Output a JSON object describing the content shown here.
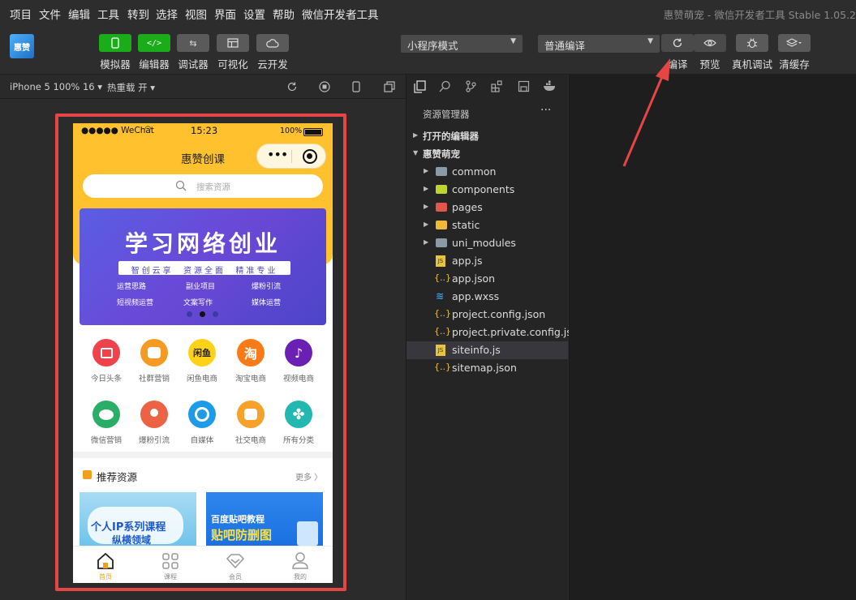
{
  "menu": [
    "项目",
    "文件",
    "编辑",
    "工具",
    "转到",
    "选择",
    "视图",
    "界面",
    "设置",
    "帮助",
    "微信开发者工具"
  ],
  "window_title": "惠赞萌宠 - 微信开发者工具 Stable 1.05.2",
  "logo_text": "惠赞",
  "toolbar": {
    "left_buttons": [
      "模拟器",
      "编辑器",
      "调试器",
      "可视化",
      "云开发"
    ],
    "mode_select": "小程序模式",
    "compile_select": "普通编译",
    "right_buttons": [
      "编译",
      "预览",
      "真机调试",
      "清缓存"
    ]
  },
  "simulator_bar": {
    "device": "iPhone 5 100% 16",
    "hot_reload": "热重载 开"
  },
  "explorer": {
    "title": "资源管理器",
    "more": "···",
    "open_editors": "打开的编辑器",
    "project": "惠赞萌宠",
    "folders": [
      "common",
      "components",
      "pages",
      "static",
      "uni_modules"
    ],
    "files": [
      "app.js",
      "app.json",
      "app.wxss",
      "project.config.json",
      "project.private.config.js...",
      "siteinfo.js",
      "sitemap.json"
    ],
    "selected": "siteinfo.js"
  },
  "phone": {
    "status_carrier": "●●●●● WeChat",
    "status_time": "15:23",
    "status_battery": "100%",
    "nav_title": "惠赞创课",
    "capsule_dots": "•••",
    "search_placeholder": "搜索资源",
    "banner": {
      "title": "学习网络创业",
      "subtitle": "智创云享  资源全面  精准专业",
      "tags": [
        "运营思路",
        "副业项目",
        "爆粉引流",
        "短视频运营",
        "文案写作",
        "媒体运营"
      ]
    },
    "categories": [
      {
        "label": "今日头条",
        "color": "#f0424b",
        "icon": "toutiao-icon"
      },
      {
        "label": "社群营销",
        "color": "#f59a23",
        "icon": "community-icon"
      },
      {
        "label": "闲鱼电商",
        "color": "#ffd21a",
        "icon": "xianyu-icon",
        "text": "闲鱼"
      },
      {
        "label": "淘宝电商",
        "color": "#fb7a18",
        "icon": "taobao-icon",
        "text": "淘"
      },
      {
        "label": "视频电商",
        "color": "#6a21b3",
        "icon": "douyin-icon"
      },
      {
        "label": "微信营销",
        "color": "#2aae67",
        "icon": "wechat-icon"
      },
      {
        "label": "爆粉引流",
        "color": "#ec6245",
        "icon": "fans-icon"
      },
      {
        "label": "自媒体",
        "color": "#1e9be8",
        "icon": "media-icon"
      },
      {
        "label": "社交电商",
        "color": "#f5a12a",
        "icon": "social-icon"
      },
      {
        "label": "所有分类",
        "color": "#22b8b1",
        "icon": "all-categories-icon"
      }
    ],
    "section_title": "推荐资源",
    "section_more": "更多",
    "cards": [
      {
        "title": "个人IP系列课程",
        "subtitle": "纵横领域"
      },
      {
        "title": "百度贴吧教程",
        "subtitle": "贴吧防删图"
      }
    ],
    "tabs": [
      "首页",
      "课程",
      "会员",
      "我的"
    ],
    "active_tab": "首页"
  },
  "colors": {
    "accent_green": "#1aad19",
    "highlight_red": "#e54545",
    "phone_header": "#ffc12e",
    "active_tab": "#f2a01b"
  }
}
